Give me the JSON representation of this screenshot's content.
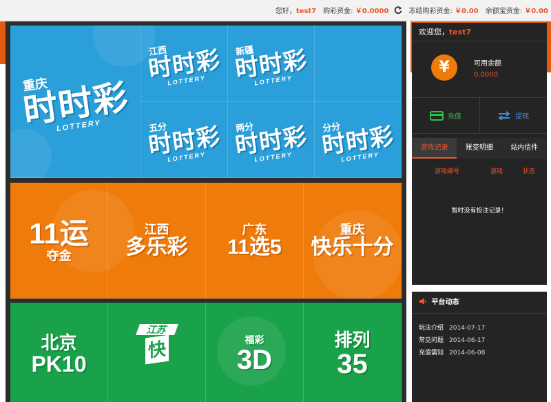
{
  "topbar": {
    "greeting": "您好，",
    "username": "test7",
    "lottery_funds_label": "购彩资金:",
    "lottery_funds_value": "￥0.0000",
    "frozen_funds_label": "冻结购彩资金:",
    "frozen_funds_value": "￥0.00",
    "yuebao_label": "余额宝资金:",
    "yuebao_value": "￥0.00"
  },
  "games": {
    "blue": [
      {
        "prefix": "重庆",
        "main": "时时彩",
        "sub": "LOTTERY"
      },
      {
        "prefix": "江西",
        "main": "时时彩",
        "sub": "LOTTERY"
      },
      {
        "prefix": "新疆",
        "main": "时时彩",
        "sub": "LOTTERY"
      },
      {
        "prefix": "五分",
        "main": "时时彩",
        "sub": "LOTTERY"
      },
      {
        "prefix": "两分",
        "main": "时时彩",
        "sub": "LOTTERY"
      },
      {
        "prefix": "分分",
        "main": "时时彩",
        "sub": "LOTTERY"
      }
    ],
    "orange": [
      {
        "l1": "11运",
        "l2": "夺金"
      },
      {
        "l1": "江西",
        "l2": "多乐彩"
      },
      {
        "l1": "广东",
        "l2": "11选5"
      },
      {
        "l1": "重庆",
        "l2": "快乐十分"
      }
    ],
    "green": [
      {
        "l1": "北京",
        "l2": "PK10"
      },
      {
        "l1": "江苏",
        "l2": "快3"
      },
      {
        "l1": "福彩",
        "l2": "3D"
      },
      {
        "l1": "排列",
        "l2": "35"
      }
    ]
  },
  "sidebar": {
    "welcome_label": "欢迎您，",
    "welcome_user": "test7",
    "balance_label": "可用余额",
    "balance_value": "0.0000",
    "currency_symbol": "¥",
    "recharge_label": "充值",
    "withdraw_label": "提现",
    "tabs": [
      "游戏记录",
      "账变明细",
      "站内信件"
    ],
    "record_columns": [
      "游戏编号",
      "游戏",
      "状态"
    ],
    "empty_text": "暂时没有投注记录！"
  },
  "news": {
    "title": "平台动态",
    "items": [
      {
        "title": "玩法介绍",
        "date": "2014-07-17"
      },
      {
        "title": "常见问题",
        "date": "2014-06-17"
      },
      {
        "title": "充值需知",
        "date": "2014-06-08"
      }
    ]
  },
  "colors": {
    "accent": "#e8562a",
    "blue_panel": "#2a9fd9",
    "orange_panel": "#ef7b0b",
    "green_panel": "#1aa24b",
    "sidebar_bg": "#242424"
  }
}
